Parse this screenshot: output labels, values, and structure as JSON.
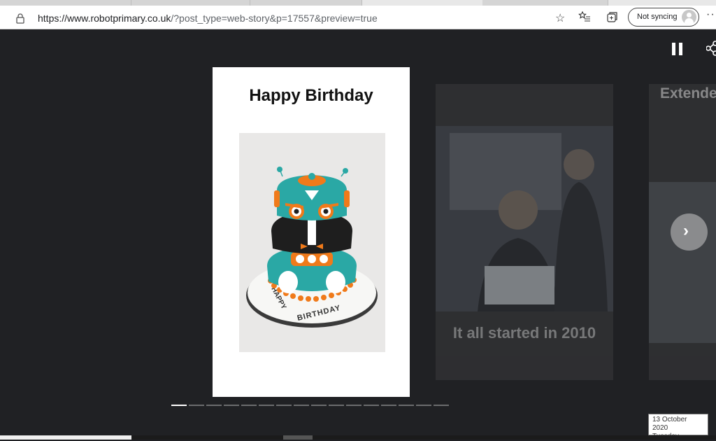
{
  "browser": {
    "url_host": "https://www.robotprimary.co.uk",
    "url_rest": "/?post_type=web-story&p=17557&preview=true",
    "sync_label": "Not syncing",
    "more_label": "···"
  },
  "story": {
    "main_card": {
      "title": "Happy Birthday",
      "cake_text_top": "HAPPY",
      "cake_text_bottom": "BIRTHDAY"
    },
    "next_card": {
      "title": "It all started in 2010"
    },
    "third_card": {
      "title": "Extende Helpers"
    },
    "progress": {
      "segments": 16,
      "active_index": 0
    }
  },
  "tooltip": {
    "date": "13 October 2020",
    "day": "Tuesday"
  },
  "colors": {
    "background": "#202124",
    "cake_teal": "#2aa8a5",
    "cake_orange": "#f07a1a",
    "cake_black": "#1e1e1e"
  }
}
